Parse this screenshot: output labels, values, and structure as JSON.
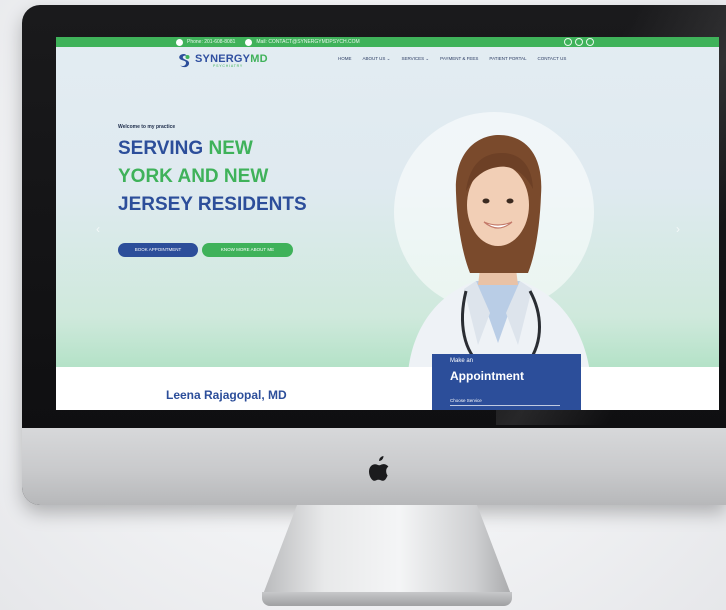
{
  "topbar": {
    "phone": "Phone: 201-608-8081",
    "mail": "Mail: CONTACT@SYNERGYMDPSYCH.COM"
  },
  "logo": {
    "name_a": "SYNERGY",
    "name_b": "MD",
    "tagline": "PSYCHIATRY"
  },
  "nav": [
    "HOME",
    "ABOUT US ⌄",
    "SERVICES ⌄",
    "PAYMENT & FEES",
    "PATIENT PORTAL",
    "CONTACT US"
  ],
  "hero": {
    "welcome": "Welcome to my practice",
    "line1a": "SERVING ",
    "line1b": "NEW",
    "line2a": "YORK AND ",
    "line2b": "NEW",
    "line3": "JERSEY RESIDENTS",
    "book_label": "BOOK APPOINTMENT",
    "know_label": "KNOW MORE ABOUT ME"
  },
  "doctor_name": "Leena Rajagopal, MD",
  "appointment": {
    "make": "Make an",
    "title": "Appointment",
    "select_placeholder": "Choose Service"
  },
  "colors": {
    "brand_blue": "#2c4e9a",
    "brand_green": "#3fb25a"
  },
  "icons": [
    "phone-icon",
    "mail-icon",
    "facebook-icon",
    "twitter-icon",
    "instagram-icon",
    "apple-logo-icon",
    "chevron-left-icon",
    "chevron-right-icon"
  ]
}
